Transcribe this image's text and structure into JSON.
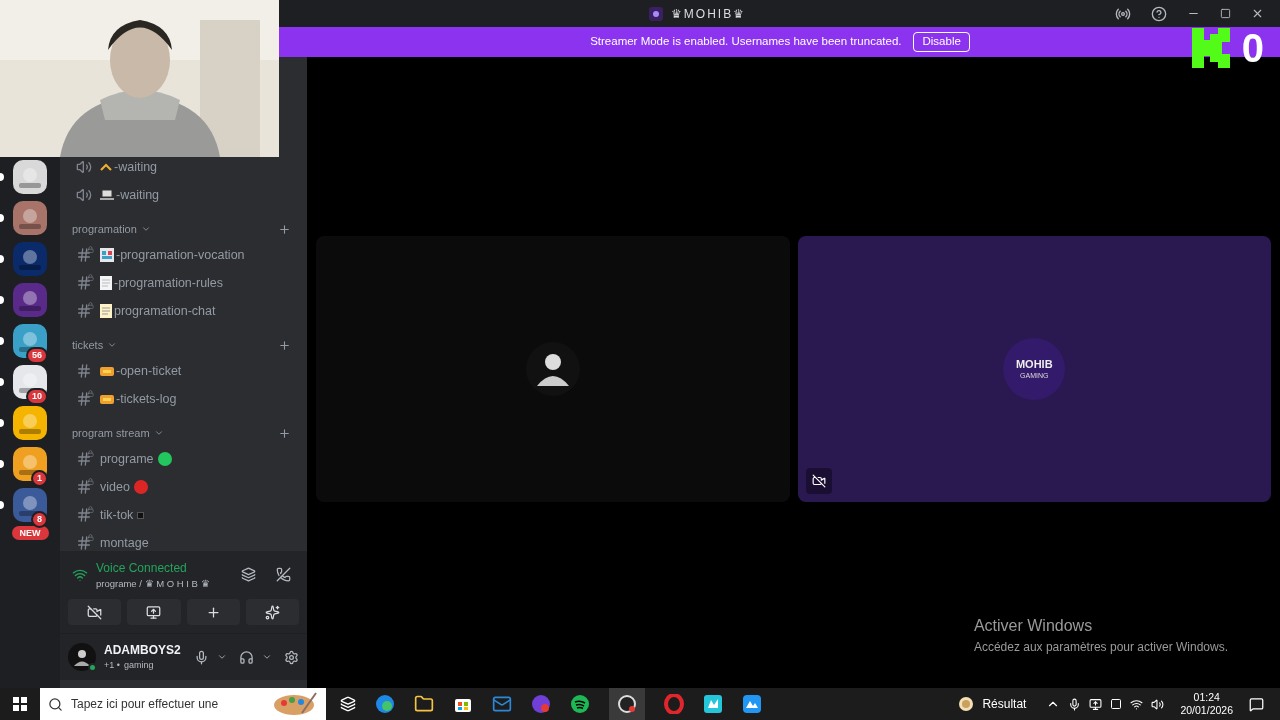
{
  "window": {
    "title": "♛MOHIB♛"
  },
  "banner": {
    "text": "Streamer Mode is enabled. Usernames have been truncated.",
    "button": "Disable"
  },
  "overlay_counter": "0",
  "servers": [
    {
      "color": "#d9d9d9",
      "unread": true
    },
    {
      "color": "#a8746a",
      "unread": true
    },
    {
      "color": "#0a2a6a",
      "unread": true
    },
    {
      "color": "#5a2a8a",
      "unread": true
    },
    {
      "color": "#3aa0c8",
      "unread": true,
      "badge": "56"
    },
    {
      "color": "#e5e7eb",
      "unread": true,
      "badge": "10"
    },
    {
      "color": "#f5b400",
      "unread": true
    },
    {
      "color": "#f0a020",
      "unread": true,
      "badge": "1"
    },
    {
      "color": "#3b5a9a",
      "unread": true,
      "badge": "8"
    }
  ],
  "new_badge": "NEW",
  "categories": [
    {
      "channels": [
        {
          "name": "-waiting",
          "kind": "voice_caret"
        },
        {
          "name": "-waiting",
          "kind": "voice_laptop"
        }
      ]
    },
    {
      "name": "programation",
      "channels": [
        {
          "name": "-programation-vocation",
          "kind": "text_calendar"
        },
        {
          "name": "-programation-rules",
          "kind": "text_page"
        },
        {
          "name": "programation-chat",
          "kind": "text_memo"
        }
      ]
    },
    {
      "name": "tickets",
      "channels": [
        {
          "name": "-open-ticket",
          "kind": "open_ticket"
        },
        {
          "name": "-tickets-log",
          "kind": "text_ticket"
        }
      ]
    },
    {
      "name": "program stream",
      "channels": [
        {
          "name": "programe",
          "kind": "text",
          "color": "#22c55e"
        },
        {
          "name": "video",
          "kind": "text",
          "color": "#dc2626"
        },
        {
          "name": "tik-tok",
          "kind": "text",
          "color": "#111111"
        },
        {
          "name": "montage",
          "kind": "text"
        }
      ]
    }
  ],
  "voice": {
    "status": "Voice Connected",
    "location": "programe / ♛ M O H I B ♛"
  },
  "user": {
    "name": "ADAMBOYS2",
    "activity": "+1 •",
    "game": "gaming"
  },
  "tiles": [
    {
      "kind": "avatar"
    },
    {
      "kind": "logo",
      "logo_title": "MOHIB",
      "logo_subtitle": "GAMING"
    }
  ],
  "watermark": {
    "title": "Activer Windows",
    "subtitle": "Accédez aux paramètres pour activer Windows."
  },
  "taskbar": {
    "search_placeholder": "Tapez ici pour effectuer une",
    "weather": "Résultat",
    "time": "01:24",
    "date": "20/01/2026"
  }
}
